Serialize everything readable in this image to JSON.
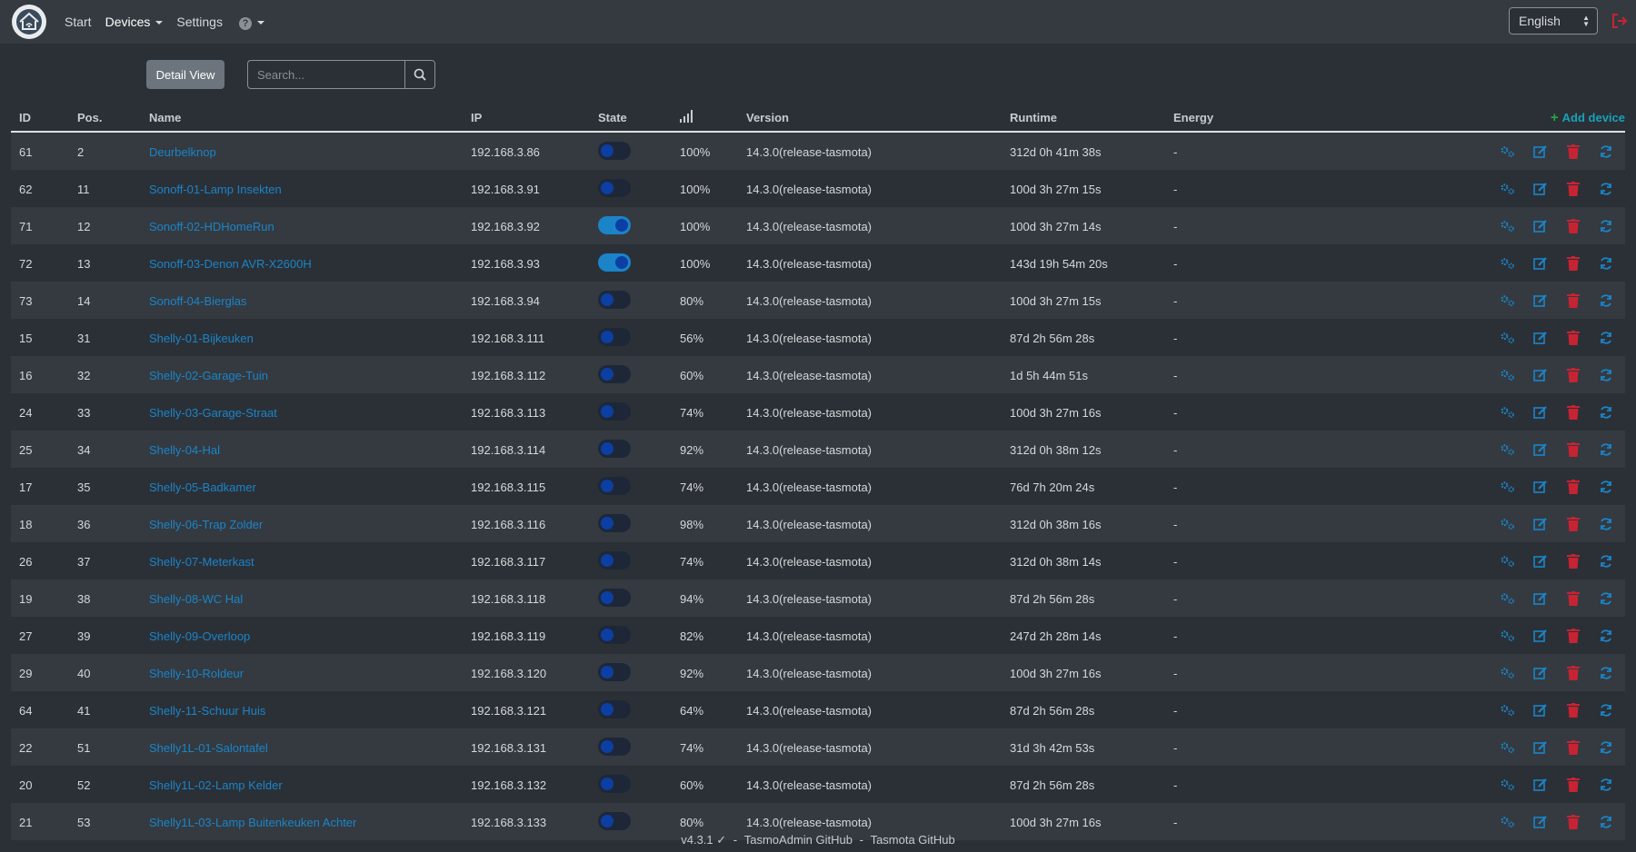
{
  "nav": {
    "start": "Start",
    "devices": "Devices",
    "settings": "Settings",
    "help": "?",
    "language": "English"
  },
  "toolbar": {
    "detail_view": "Detail View",
    "search_placeholder": "Search..."
  },
  "table": {
    "headers": {
      "id": "ID",
      "pos": "Pos.",
      "name": "Name",
      "ip": "IP",
      "state": "State",
      "version": "Version",
      "runtime": "Runtime",
      "energy": "Energy",
      "add": "Add device"
    },
    "rows": [
      {
        "id": "61",
        "pos": "2",
        "name": "Deurbelknop",
        "ip": "192.168.3.86",
        "on": false,
        "signal": "100%",
        "version": "14.3.0(release-tasmota)",
        "runtime": "312d 0h 41m 38s",
        "energy": "-"
      },
      {
        "id": "62",
        "pos": "11",
        "name": "Sonoff-01-Lamp Insekten",
        "ip": "192.168.3.91",
        "on": false,
        "signal": "100%",
        "version": "14.3.0(release-tasmota)",
        "runtime": "100d 3h 27m 15s",
        "energy": "-"
      },
      {
        "id": "71",
        "pos": "12",
        "name": "Sonoff-02-HDHomeRun",
        "ip": "192.168.3.92",
        "on": true,
        "signal": "100%",
        "version": "14.3.0(release-tasmota)",
        "runtime": "100d 3h 27m 14s",
        "energy": "-"
      },
      {
        "id": "72",
        "pos": "13",
        "name": "Sonoff-03-Denon AVR-X2600H",
        "ip": "192.168.3.93",
        "on": true,
        "signal": "100%",
        "version": "14.3.0(release-tasmota)",
        "runtime": "143d 19h 54m 20s",
        "energy": "-"
      },
      {
        "id": "73",
        "pos": "14",
        "name": "Sonoff-04-Bierglas",
        "ip": "192.168.3.94",
        "on": false,
        "signal": "80%",
        "version": "14.3.0(release-tasmota)",
        "runtime": "100d 3h 27m 15s",
        "energy": "-"
      },
      {
        "id": "15",
        "pos": "31",
        "name": "Shelly-01-Bijkeuken",
        "ip": "192.168.3.111",
        "on": false,
        "signal": "56%",
        "version": "14.3.0(release-tasmota)",
        "runtime": "87d 2h 56m 28s",
        "energy": "-"
      },
      {
        "id": "16",
        "pos": "32",
        "name": "Shelly-02-Garage-Tuin",
        "ip": "192.168.3.112",
        "on": false,
        "signal": "60%",
        "version": "14.3.0(release-tasmota)",
        "runtime": "1d 5h 44m 51s",
        "energy": "-"
      },
      {
        "id": "24",
        "pos": "33",
        "name": "Shelly-03-Garage-Straat",
        "ip": "192.168.3.113",
        "on": false,
        "signal": "74%",
        "version": "14.3.0(release-tasmota)",
        "runtime": "100d 3h 27m 16s",
        "energy": "-"
      },
      {
        "id": "25",
        "pos": "34",
        "name": "Shelly-04-Hal",
        "ip": "192.168.3.114",
        "on": false,
        "signal": "92%",
        "version": "14.3.0(release-tasmota)",
        "runtime": "312d 0h 38m 12s",
        "energy": "-"
      },
      {
        "id": "17",
        "pos": "35",
        "name": "Shelly-05-Badkamer",
        "ip": "192.168.3.115",
        "on": false,
        "signal": "74%",
        "version": "14.3.0(release-tasmota)",
        "runtime": "76d 7h 20m 24s",
        "energy": "-"
      },
      {
        "id": "18",
        "pos": "36",
        "name": "Shelly-06-Trap Zolder",
        "ip": "192.168.3.116",
        "on": false,
        "signal": "98%",
        "version": "14.3.0(release-tasmota)",
        "runtime": "312d 0h 38m 16s",
        "energy": "-"
      },
      {
        "id": "26",
        "pos": "37",
        "name": "Shelly-07-Meterkast",
        "ip": "192.168.3.117",
        "on": false,
        "signal": "74%",
        "version": "14.3.0(release-tasmota)",
        "runtime": "312d 0h 38m 14s",
        "energy": "-"
      },
      {
        "id": "19",
        "pos": "38",
        "name": "Shelly-08-WC Hal",
        "ip": "192.168.3.118",
        "on": false,
        "signal": "94%",
        "version": "14.3.0(release-tasmota)",
        "runtime": "87d 2h 56m 28s",
        "energy": "-"
      },
      {
        "id": "27",
        "pos": "39",
        "name": "Shelly-09-Overloop",
        "ip": "192.168.3.119",
        "on": false,
        "signal": "82%",
        "version": "14.3.0(release-tasmota)",
        "runtime": "247d 2h 28m 14s",
        "energy": "-"
      },
      {
        "id": "29",
        "pos": "40",
        "name": "Shelly-10-Roldeur",
        "ip": "192.168.3.120",
        "on": false,
        "signal": "92%",
        "version": "14.3.0(release-tasmota)",
        "runtime": "100d 3h 27m 16s",
        "energy": "-"
      },
      {
        "id": "64",
        "pos": "41",
        "name": "Shelly-11-Schuur Huis",
        "ip": "192.168.3.121",
        "on": false,
        "signal": "64%",
        "version": "14.3.0(release-tasmota)",
        "runtime": "87d 2h 56m 28s",
        "energy": "-"
      },
      {
        "id": "22",
        "pos": "51",
        "name": "Shelly1L-01-Salontafel",
        "ip": "192.168.3.131",
        "on": false,
        "signal": "74%",
        "version": "14.3.0(release-tasmota)",
        "runtime": "31d 3h 42m 53s",
        "energy": "-"
      },
      {
        "id": "20",
        "pos": "52",
        "name": "Shelly1L-02-Lamp Kelder",
        "ip": "192.168.3.132",
        "on": false,
        "signal": "60%",
        "version": "14.3.0(release-tasmota)",
        "runtime": "87d 2h 56m 28s",
        "energy": "-"
      },
      {
        "id": "21",
        "pos": "53",
        "name": "Shelly1L-03-Lamp Buitenkeuken Achter",
        "ip": "192.168.3.133",
        "on": false,
        "signal": "80%",
        "version": "14.3.0(release-tasmota)",
        "runtime": "100d 3h 27m 16s",
        "energy": "-"
      }
    ]
  },
  "footer": {
    "version": "v4.3.1 ✓",
    "sep": "-",
    "link1": "TasmoAdmin GitHub",
    "link2": "Tasmota GitHub"
  },
  "colors": {
    "accent": "#1b84c9",
    "delete": "#c82333",
    "add": "#28a745"
  }
}
